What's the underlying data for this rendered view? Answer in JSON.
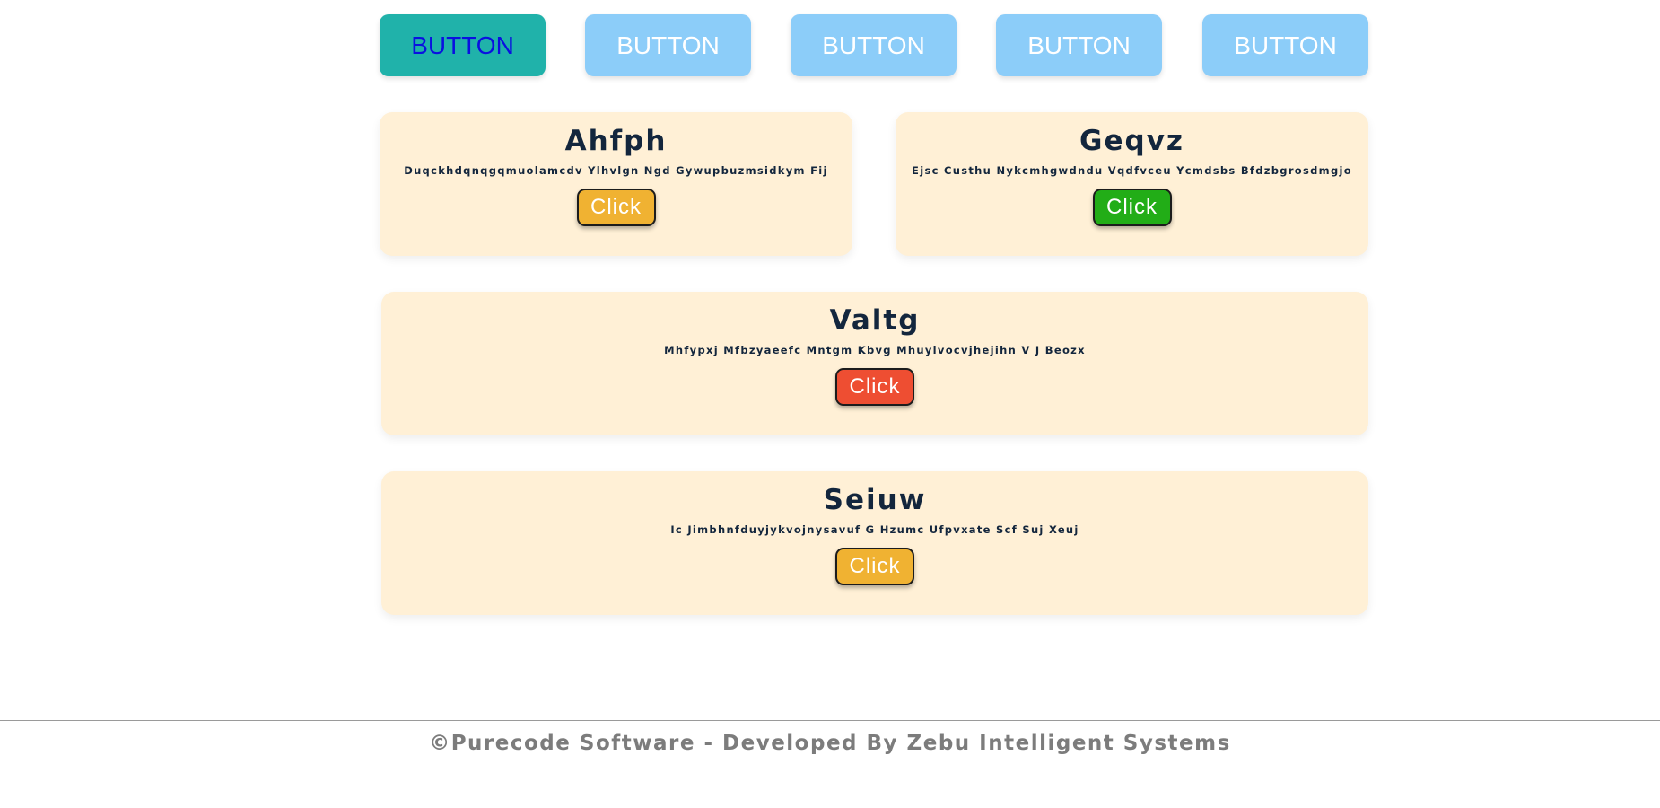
{
  "top_buttons": [
    {
      "label": "BUTTON",
      "active": true
    },
    {
      "label": "BUTTON",
      "active": false
    },
    {
      "label": "BUTTON",
      "active": false
    },
    {
      "label": "BUTTON",
      "active": false
    },
    {
      "label": "BUTTON",
      "active": false
    }
  ],
  "cards": [
    {
      "title": "Ahfph",
      "description": "Duqckhdqnqgqmuolamcdv Ylhvlgn Ngd Gywupbuzmsidkym Fij",
      "button_label": "Click",
      "button_color": "#f0b232"
    },
    {
      "title": "Geqvz",
      "description": "Ejsc Custhu Nykcmhgwdndu Vqdfvceu Ycmdsbs Bfdzbgrosdmgjo",
      "button_label": "Click",
      "button_color": "#22ad17"
    },
    {
      "title": "Valtg",
      "description": "Mhfypxj Mfbzyaeefc Mntgm Kbvg Mhuylvocvjhejihn V J Beozx",
      "button_label": "Click",
      "button_color": "#ee4e32"
    },
    {
      "title": "Seiuw",
      "description": "Ic Jimbhnfduyjykvojnysavuf G Hzumc Ufpvxate Scf Suj Xeuj",
      "button_label": "Click",
      "button_color": "#f0b232"
    }
  ],
  "footer": {
    "text": "©Purecode Software - Developed By Zebu Intelligent Systems"
  },
  "colors": {
    "top_button_active_bg": "#20b2aa",
    "top_button_active_text": "#0a10e0",
    "top_button_bg": "#8ccdf9",
    "card_bg": "#fff0d6",
    "title_text": "#13263d",
    "footer_text": "#7c7c7c"
  }
}
